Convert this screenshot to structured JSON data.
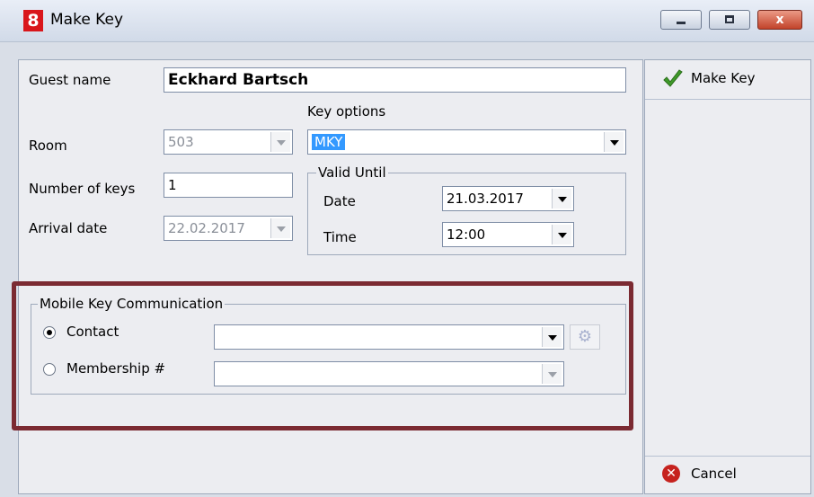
{
  "window": {
    "app_icon": "8",
    "title": "Make Key",
    "close_glyph": "x"
  },
  "form": {
    "guest_name_label": "Guest name",
    "guest_name_value": "Eckhard Bartsch",
    "room_label": "Room",
    "room_value": "503",
    "number_of_keys_label": "Number of keys",
    "number_of_keys_value": "1",
    "arrival_date_label": "Arrival date",
    "arrival_date_value": "22.02.2017",
    "key_options_label": "Key options",
    "key_options_value": "MKY"
  },
  "valid_until": {
    "group_label": "Valid Until",
    "date_label": "Date",
    "date_value": "21.03.2017",
    "time_label": "Time",
    "time_value": "12:00"
  },
  "mobile_key": {
    "group_label": "Mobile Key Communication",
    "contact_label": "Contact",
    "contact_value": "",
    "membership_label": "Membership #",
    "membership_value": "",
    "contact_selected": true,
    "highlight_color": "#7b2a32"
  },
  "actions": {
    "make_key_label": "Make Key",
    "cancel_label": "Cancel",
    "make_key_icon": "checkmark-icon",
    "cancel_icon": "cancel-icon"
  }
}
